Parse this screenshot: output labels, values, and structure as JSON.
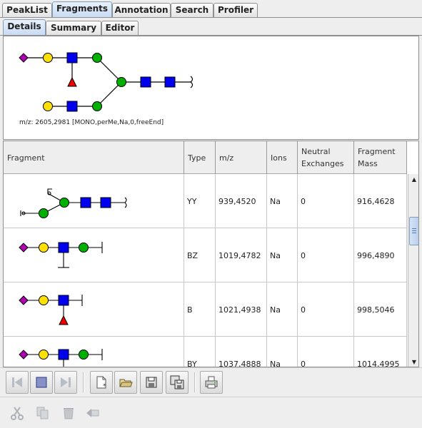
{
  "main_tabs": [
    {
      "label": "PeakList",
      "active": false
    },
    {
      "label": "Fragments",
      "active": true
    },
    {
      "label": "Annotation",
      "active": false
    },
    {
      "label": "Search",
      "active": false
    },
    {
      "label": "Profiler",
      "active": false
    }
  ],
  "sub_tabs": [
    {
      "label": "Details",
      "active": true
    },
    {
      "label": "Summary",
      "active": false
    },
    {
      "label": "Editor",
      "active": false
    }
  ],
  "structure": {
    "mz_text": "m/z: 2605,2981 [MONO,perMe,Na,0,freeEnd]"
  },
  "table": {
    "columns": [
      "Fragment",
      "Type",
      "m/z",
      "Ions",
      "Neutral\nExchanges",
      "Fragment\nMass"
    ],
    "rows": [
      {
        "type": "YY",
        "mz": "939,4520",
        "ions": "Na",
        "neutral": "0",
        "mass": "916,4628"
      },
      {
        "type": "BZ",
        "mz": "1019,4782",
        "ions": "Na",
        "neutral": "0",
        "mass": "996,4890"
      },
      {
        "type": "B",
        "mz": "1021,4938",
        "ions": "Na",
        "neutral": "0",
        "mass": "998,5046"
      },
      {
        "type": "BY",
        "mz": "1037,4888",
        "ions": "Na",
        "neutral": "0",
        "mass": "1014,4995"
      }
    ]
  },
  "colors": {
    "sialic_acid": "#b000b0",
    "galactose": "#ffe000",
    "glcnac": "#0000ee",
    "mannose": "#00b000",
    "fucose": "#ee0000",
    "active_tab": "#c8dcf3"
  },
  "icons": {
    "toolbar1": [
      "step-back-icon",
      "stop-icon",
      "step-forward-icon",
      "new-document-icon",
      "open-folder-icon",
      "save-icon",
      "save-all-icon",
      "print-icon"
    ],
    "toolbar2": [
      "cut-icon",
      "copy-icon",
      "delete-icon",
      "paste-icon"
    ]
  }
}
